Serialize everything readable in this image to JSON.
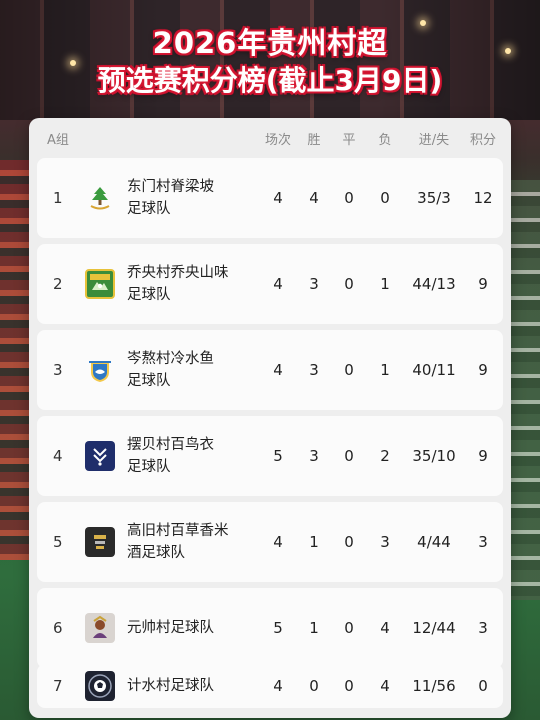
{
  "title": {
    "line1": "2026年贵州村超",
    "line2": "预选赛积分榜(截止3月9日)"
  },
  "table": {
    "headers": {
      "group": "A组",
      "played": "场次",
      "won": "胜",
      "drawn": "平",
      "lost": "负",
      "goals": "进/失",
      "points": "积分"
    },
    "rows": [
      {
        "rank": "1",
        "name_line1": "东门村脊梁坡",
        "name_line2": "足球队",
        "logo_icon": "green-tree-emblem-icon",
        "played": "4",
        "won": "4",
        "drawn": "0",
        "lost": "0",
        "goals": "35/3",
        "points": "12"
      },
      {
        "rank": "2",
        "name_line1": "乔央村乔央山味",
        "name_line2": "足球队",
        "logo_icon": "green-gold-badge-icon",
        "played": "4",
        "won": "3",
        "drawn": "0",
        "lost": "1",
        "goals": "44/13",
        "points": "9"
      },
      {
        "rank": "3",
        "name_line1": "岑熬村冷水鱼",
        "name_line2": "足球队",
        "logo_icon": "blue-fish-crest-icon",
        "played": "4",
        "won": "3",
        "drawn": "0",
        "lost": "1",
        "goals": "40/11",
        "points": "9"
      },
      {
        "rank": "4",
        "name_line1": "摆贝村百鸟衣",
        "name_line2": "足球队",
        "logo_icon": "navy-shield-icon",
        "played": "5",
        "won": "3",
        "drawn": "0",
        "lost": "2",
        "goals": "35/10",
        "points": "9"
      },
      {
        "rank": "5",
        "name_line1": "高旧村百草香米",
        "name_line2": "酒足球队",
        "logo_icon": "dark-shield-icon",
        "played": "4",
        "won": "1",
        "drawn": "0",
        "lost": "3",
        "goals": "4/44",
        "points": "3"
      },
      {
        "rank": "6",
        "name_line1": "元帅村足球队",
        "name_line2": "",
        "logo_icon": "marshal-emblem-icon",
        "played": "5",
        "won": "1",
        "drawn": "0",
        "lost": "4",
        "goals": "12/44",
        "points": "3"
      },
      {
        "rank": "7",
        "name_line1": "计水村足球队",
        "name_line2": "",
        "logo_icon": "round-ball-badge-icon",
        "played": "4",
        "won": "0",
        "drawn": "0",
        "lost": "4",
        "goals": "11/56",
        "points": "0"
      }
    ]
  },
  "colors": {
    "title_text": "#ffffff",
    "title_outline": "#c8102e",
    "card_bg": "#eeeeee",
    "row_bg": "#fbfbfb",
    "header_text": "#8a8a8a"
  }
}
